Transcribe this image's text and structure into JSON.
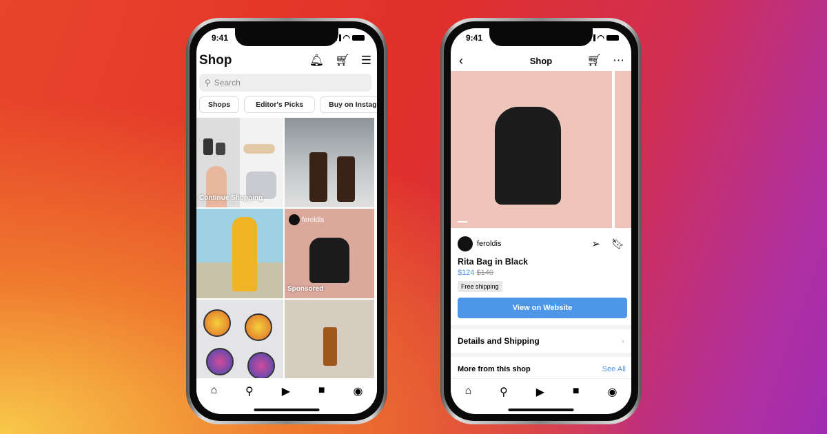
{
  "status_time": "9:41",
  "left_phone": {
    "title": "Shop",
    "search_placeholder": "Search",
    "chips": [
      "Shops",
      "Editor's Picks",
      "Buy on Instag"
    ],
    "tiles": {
      "continue": "Continue Shopping",
      "account": "feroldis",
      "sponsored": "Sponsored"
    },
    "nav_icons": [
      "home-icon",
      "search-icon",
      "reels-icon",
      "shop-icon",
      "profile-icon"
    ]
  },
  "right_phone": {
    "title": "Shop",
    "account": "feroldis",
    "product_name": "Rita Bag in Black",
    "price": "$124",
    "original_price": "$140",
    "shipping_badge": "Free shipping",
    "cta": "View on Website",
    "details": "Details and Shipping",
    "more": "More from this shop",
    "see_all": "See All"
  },
  "colors": {
    "accent": "#4d96e8",
    "product_bg": "#efc5bb"
  }
}
